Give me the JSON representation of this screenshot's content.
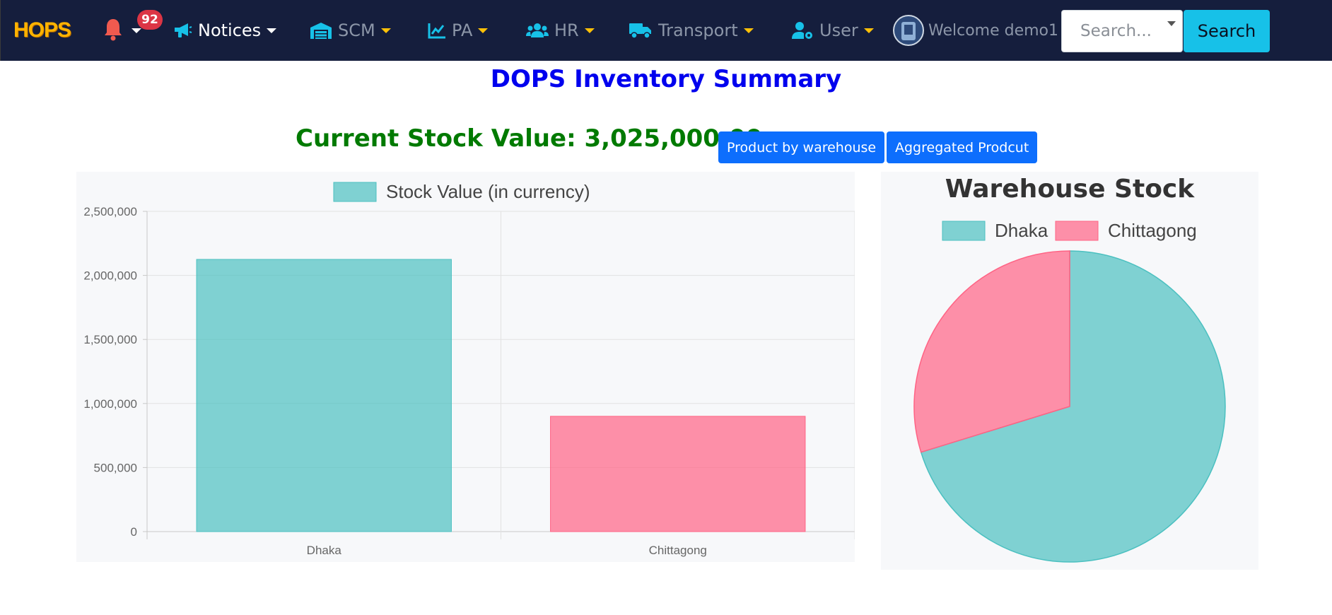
{
  "navbar": {
    "brand": "HOPS",
    "notification_count": "92",
    "items": [
      {
        "label": "Notices",
        "icon": "megaphone-icon"
      },
      {
        "label": "SCM",
        "icon": "warehouse-icon"
      },
      {
        "label": "PA",
        "icon": "chart-line-icon"
      },
      {
        "label": "HR",
        "icon": "users-icon"
      },
      {
        "label": "Transport",
        "icon": "truck-icon"
      },
      {
        "label": "User",
        "icon": "user-cog-icon"
      }
    ],
    "welcome": "Welcome demo1",
    "search_placeholder": "Search...",
    "search_button": "Search"
  },
  "page": {
    "title": "DOPS Inventory Summary",
    "stock_value_label": "Current Stock Value: 3,025,000.00",
    "buttons": {
      "product_by_warehouse": "Product by warehouse",
      "aggregated_product": "Aggregated Prodcut"
    }
  },
  "colors": {
    "navbar_bg": "#151e3d",
    "teal": "#4bc0c0",
    "pink": "#ff6384",
    "title_blue": "#0000ee",
    "stock_green": "#007a00",
    "button_blue": "#0d6efd"
  },
  "chart_data": [
    {
      "type": "bar",
      "categories": [
        "Dhaka",
        "Chittagong"
      ],
      "series": [
        {
          "name": "Stock Value (in currency)",
          "values": [
            2125000,
            900000
          ]
        }
      ],
      "colors": [
        "#4bc0c0",
        "#ff6384"
      ],
      "ylim": [
        0,
        2500000
      ],
      "yticks": [
        "0",
        "500,000",
        "1,000,000",
        "1,500,000",
        "2,000,000",
        "2,500,000"
      ],
      "grid": true,
      "legend": "top"
    },
    {
      "type": "pie",
      "title": "Warehouse Stock",
      "labels": [
        "Dhaka",
        "Chittagong"
      ],
      "values": [
        2125000,
        900000
      ],
      "colors": [
        "#4bc0c0",
        "#ff6384"
      ],
      "legend": "top"
    }
  ]
}
